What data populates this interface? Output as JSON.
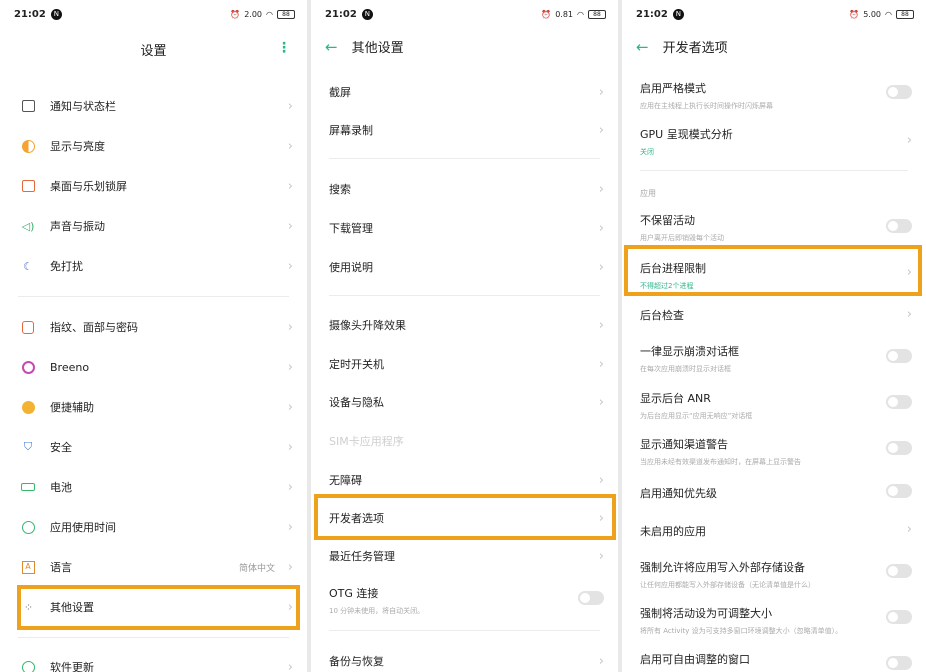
{
  "status": {
    "time": "21:02",
    "badge": "N",
    "net1": "2.00",
    "net2": "0.81",
    "net3": "5.00",
    "battery": "88"
  },
  "panel1": {
    "title": "设置",
    "more_icon": "vertical-dots-icon",
    "items": [
      {
        "label": "通知与状态栏",
        "icon": "notification-icon"
      },
      {
        "label": "显示与亮度",
        "icon": "brightness-icon"
      },
      {
        "label": "桌面与乐划锁屏",
        "icon": "wallpaper-icon"
      },
      {
        "label": "声音与振动",
        "icon": "sound-icon"
      },
      {
        "label": "免打扰",
        "icon": "moon-icon"
      },
      {
        "label": "指纹、面部与密码",
        "icon": "lock-icon"
      },
      {
        "label": "Breeno",
        "icon": "breeno-icon"
      },
      {
        "label": "便捷辅助",
        "icon": "assist-icon"
      },
      {
        "label": "安全",
        "icon": "shield-icon"
      },
      {
        "label": "电池",
        "icon": "battery-icon"
      },
      {
        "label": "应用使用时间",
        "icon": "app-time-icon"
      },
      {
        "label": "语言",
        "icon": "language-icon",
        "value": "简体中文"
      },
      {
        "label": "其他设置",
        "icon": "more-settings-icon"
      },
      {
        "label": "软件更新",
        "icon": "update-icon"
      }
    ]
  },
  "panel2": {
    "title": "其他设置",
    "items": [
      {
        "label": "截屏"
      },
      {
        "label": "屏幕录制"
      },
      {
        "label": "搜索"
      },
      {
        "label": "下载管理"
      },
      {
        "label": "使用说明"
      },
      {
        "label": "摄像头升降效果"
      },
      {
        "label": "定时开关机"
      },
      {
        "label": "设备与隐私"
      },
      {
        "label": "SIM卡应用程序"
      },
      {
        "label": "无障碍"
      },
      {
        "label": "开发者选项"
      },
      {
        "label": "最近任务管理"
      },
      {
        "label": "OTG 连接",
        "sub": "10 分钟未使用，将自动关闭。"
      },
      {
        "label": "备份与恢复"
      }
    ]
  },
  "panel3": {
    "title": "开发者选项",
    "section_label": "应用",
    "items": [
      {
        "label": "启用严格模式",
        "sub": "应用在主线程上执行长时间操作时闪烁屏幕"
      },
      {
        "label": "GPU 呈现模式分析",
        "sub": "关闭"
      },
      {
        "label": "不保留活动",
        "sub": "用户离开后即销毁每个活动"
      },
      {
        "label": "后台进程限制",
        "sub": "不得超过2个进程"
      },
      {
        "label": "后台检查"
      },
      {
        "label": "一律显示崩溃对话框",
        "sub": "在每次应用崩溃时显示对话框"
      },
      {
        "label": "显示后台 ANR",
        "sub": "为后台应用显示“应用无响应”对话框"
      },
      {
        "label": "显示通知渠道警告",
        "sub": "当应用未经有效渠道发布通知时，在屏幕上显示警告"
      },
      {
        "label": "启用通知优先级"
      },
      {
        "label": "未启用的应用"
      },
      {
        "label": "强制允许将应用写入外部存储设备",
        "sub": "让任何应用都能写入外部存储设备（无论清单值是什么）"
      },
      {
        "label": "强制将活动设为可调整大小",
        "sub": "将所有 Activity 设为可支持多窗口环境调整大小（忽略清单值）。"
      },
      {
        "label": "启用可自由调整的窗口"
      }
    ]
  },
  "colors": {
    "accent": "#2bb58b",
    "highlight": "#eea21c"
  }
}
